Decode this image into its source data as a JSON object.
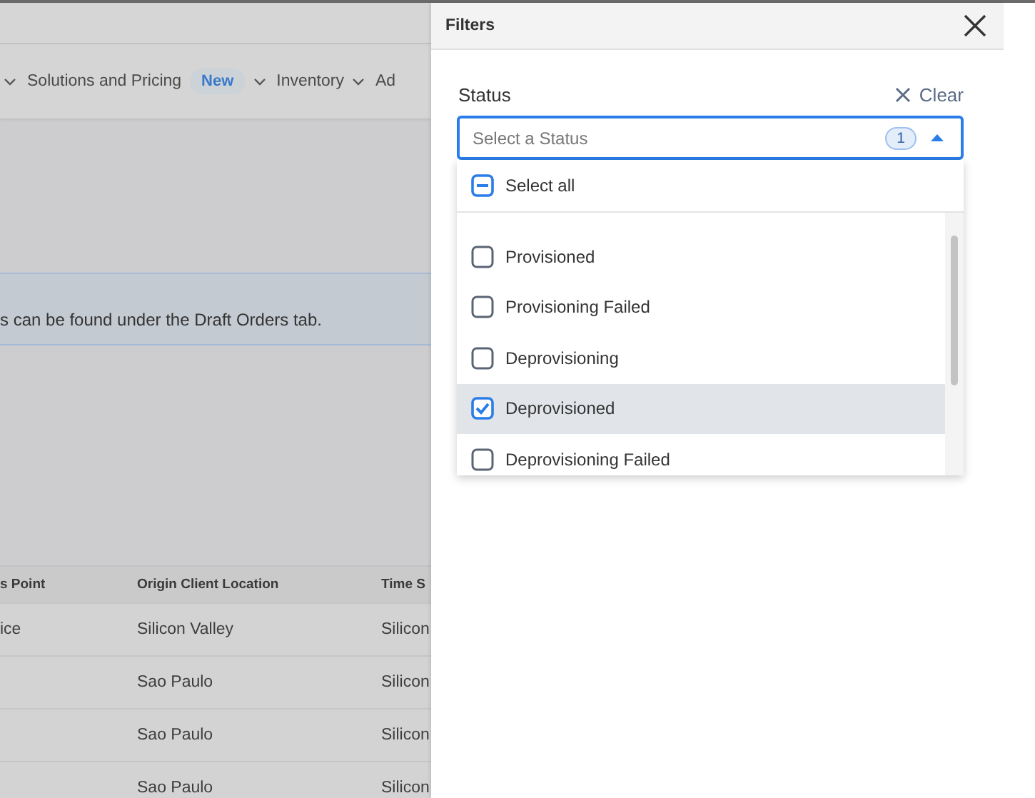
{
  "top_nav": {
    "items": [
      {
        "label": "Solutions and Pricing",
        "badge": "New",
        "has_menu": true
      },
      {
        "label": "Inventory",
        "has_menu": true
      },
      {
        "label": "Ad",
        "has_menu": false
      }
    ]
  },
  "banner": {
    "text": "s can be found under the Draft Orders tab."
  },
  "table": {
    "columns": [
      "s Point",
      "Origin Client Location",
      "Time S"
    ],
    "rows": [
      [
        "ice",
        "Silicon Valley",
        "Silicon"
      ],
      [
        null,
        "Sao Paulo",
        "Silicon"
      ],
      [
        null,
        "Sao Paulo",
        "Silicon"
      ],
      [
        null,
        "Sao Paulo",
        "Silicon"
      ]
    ]
  },
  "filters": {
    "title": "Filters",
    "status": {
      "label": "Status",
      "clear": "Clear",
      "placeholder": "Select a Status",
      "count": "1",
      "expanded": true
    },
    "select_all": {
      "label": "Select all",
      "checked": false,
      "partial": true
    },
    "options": [
      {
        "label": "Provisioned",
        "checked": false,
        "highlighted": false
      },
      {
        "label": "Provisioning Failed",
        "checked": false,
        "highlighted": false
      },
      {
        "label": "Deprovisioning",
        "checked": false,
        "highlighted": false
      },
      {
        "label": "Deprovisioned",
        "checked": true,
        "highlighted": true
      },
      {
        "label": "Deprovisioning Failed",
        "checked": false,
        "highlighted": false
      }
    ]
  }
}
